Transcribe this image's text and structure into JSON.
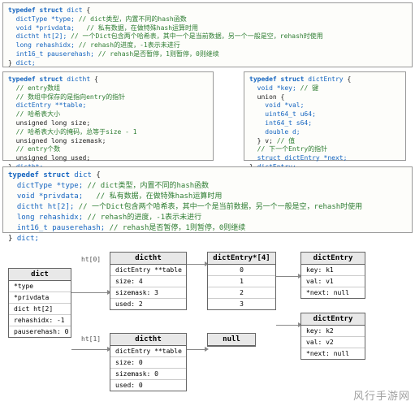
{
  "box_top": {
    "l1_kw": "typedef struct",
    "l1_name": "dict",
    "l1_brace": "{",
    "l2": "dictType *type;",
    "l2c": "// dict类型，内置不同的hash函数",
    "l3": "void *privdata;",
    "l3c": "// 私有数据，在做特殊hash运算时用",
    "l4": "dictht ht[2];",
    "l4c": "// 一个Dict包含两个哈希表，其中一个是当前数据，另一个一般是空，rehash时使用",
    "l5": "long rehashidx;",
    "l5c": "// rehash的进度，-1表示未进行",
    "l6": "int16_t pauserehash;",
    "l6c": "// rehash是否暂停，1则暂停，0则继续",
    "l7": "} ",
    "l7_name": "dict;"
  },
  "box_dictht": {
    "l1_kw": "typedef struct",
    "l1_name": "dictht",
    "l1_brace": "{",
    "l2c": "// entry数组",
    "l3c": "// 数组中保存的是指向entry的指针",
    "l4": "dictEntry **table;",
    "l5c": "// 哈希表大小",
    "l6": "unsigned long size;",
    "l7c": "// 哈希表大小的掩码，总等于size - 1",
    "l8": "unsigned long sizemask;",
    "l9c": "// entry个数",
    "l10": "unsigned long used;",
    "l11": "} ",
    "l11_name": "dictht;"
  },
  "box_entry": {
    "l1_kw": "typedef struct",
    "l1_name": "dictEntry",
    "l1_brace": "{",
    "l2": "void *key;",
    "l2c": "// 键",
    "l3": "union {",
    "l4": "void *val;",
    "l5": "uint64_t u64;",
    "l6": "int64_t s64;",
    "l7": "double d;",
    "l8": "} v;",
    "l8c": "// 值",
    "l9c": "// 下一个Entry的指针",
    "l10": "struct dictEntry *next;",
    "l11": "} ",
    "l11_name": "dictEntry;"
  },
  "box_dict2": {
    "l1_kw": "typedef struct",
    "l1_name": "dict",
    "l1_brace": "{",
    "l2a": "dictType *type;",
    "l2b": "// dict类型，内置不同的hash函数",
    "l3a": "void *privdata;",
    "l3b": "// 私有数据，在做特殊hash运算时用",
    "l4a": "dictht ht[2];",
    "l4b": "// 一个Dict包含两个哈希表，其中一个是当前数据，另一个一般是空，rehash时使用",
    "l5a": "long rehashidx;",
    "l5b": "// rehash的进度，-1表示未进行",
    "l6a": "int16_t pauserehash;",
    "l6b": "// rehash是否暂停，1则暂停，0则继续",
    "l7": "} ",
    "l7_name": "dict;"
  },
  "diagram": {
    "ht0_label": "ht[0]",
    "ht1_label": "ht[1]",
    "dict": {
      "title": "dict",
      "rows": [
        "*type",
        "*privdata",
        "dict ht[2]",
        "rehashidx: -1",
        "pauserehash: 0"
      ]
    },
    "ht0": {
      "title": "dictht",
      "rows": [
        "dictEntry **table",
        "size: 4",
        "sizemask: 3",
        "used: 2"
      ]
    },
    "ht1": {
      "title": "dictht",
      "rows": [
        "dictEntry **table",
        "size: 0",
        "sizemask: 0",
        "used: 0"
      ]
    },
    "arr": {
      "title": "dictEntry*[4]",
      "rows": [
        "0",
        "1",
        "2",
        "3"
      ]
    },
    "null_title": "null",
    "e1": {
      "title": "dictEntry",
      "rows": [
        "key: k1",
        "val: v1",
        "*next: null"
      ]
    },
    "e2": {
      "title": "dictEntry",
      "rows": [
        "key: k2",
        "val: v2",
        "*next: null"
      ]
    }
  },
  "watermark": "风行手游网"
}
